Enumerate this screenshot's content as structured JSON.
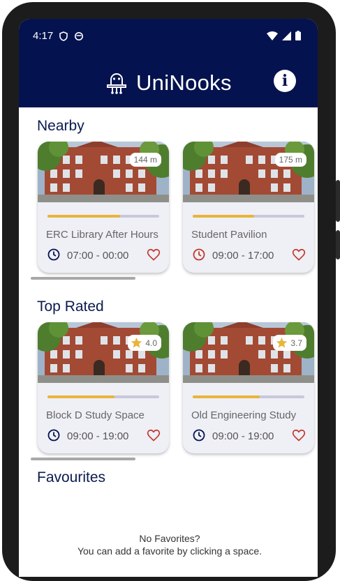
{
  "status_bar": {
    "time": "4:17"
  },
  "app": {
    "title": "UniNooks"
  },
  "sections": {
    "nearby": {
      "title": "Nearby",
      "cards": [
        {
          "name": "ERC Library After Hours",
          "hours": "07:00 - 00:00",
          "badge": "144 m",
          "progress": 0.65,
          "clock_color": "#04134f"
        },
        {
          "name": "Student Pavilion",
          "hours": "09:00 - 17:00",
          "badge": "175 m",
          "progress": 0.55,
          "clock_color": "#c0392b"
        }
      ]
    },
    "top_rated": {
      "title": "Top Rated",
      "cards": [
        {
          "name": "Block D Study Space",
          "hours": "09:00 - 19:00",
          "badge": "4.0",
          "progress": 0.6,
          "clock_color": "#04134f"
        },
        {
          "name": "Old Engineering Study",
          "hours": "09:00 - 19:00",
          "badge": "3.7",
          "progress": 0.6,
          "clock_color": "#04134f"
        }
      ]
    },
    "favourites": {
      "title": "Favourites",
      "empty_title": "No Favorites?",
      "empty_message": "You can add a favorite by clicking a space."
    }
  },
  "colors": {
    "primary": "#04134f",
    "accent": "#e8b53a",
    "heart": "#c0392b"
  }
}
